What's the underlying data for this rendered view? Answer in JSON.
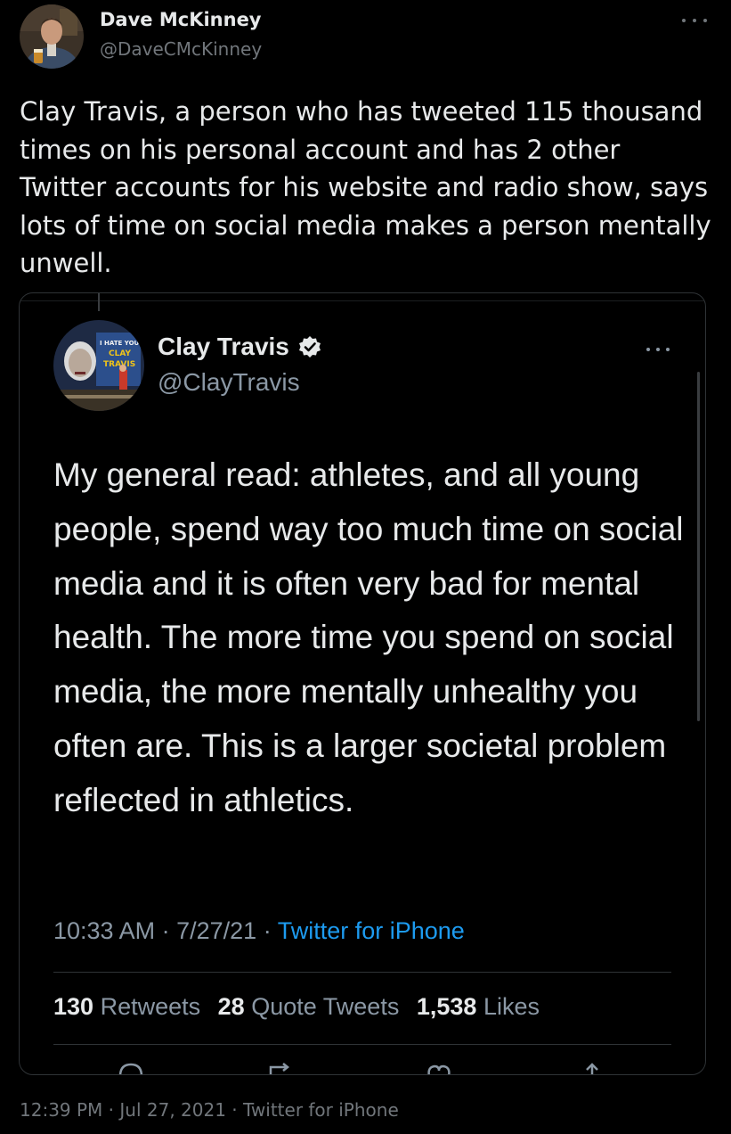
{
  "tweet": {
    "author": {
      "name": "Dave McKinney",
      "handle": "@DaveCMcKinney",
      "avatar_icon": "person-photo-icon"
    },
    "text": "Clay Travis, a person who has tweeted 115 thousand times on his personal account and has 2 other Twitter accounts for his website and radio show, says lots of time on social media makes a person mentally unwell.",
    "timestamp": "12:39 PM · Jul 27, 2021 · Twitter for iPhone",
    "more_icon": "more-dots-icon"
  },
  "quoted": {
    "author": {
      "name": "Clay Travis",
      "handle": "@ClayTravis",
      "verified": true,
      "avatar_sign_text": "I HATE YOU CLAY TRAVIS"
    },
    "text": "My general read: athletes, and all young people, spend way too much time on social media and it is often very bad for mental health. The more time you spend on social media, the more mentally unhealthy you often are. This is a larger societal problem reflected in athletics.",
    "time": "10:33 AM",
    "date": "7/27/21",
    "separator": "·",
    "source": "Twitter for iPhone",
    "stats": {
      "retweets_count": "130",
      "retweets_label": "Retweets",
      "quotes_count": "28",
      "quotes_label": "Quote Tweets",
      "likes_count": "1,538",
      "likes_label": "Likes"
    },
    "actions": [
      "reply-icon",
      "retweet-icon",
      "like-icon",
      "share-icon"
    ]
  },
  "colors": {
    "background": "#000000",
    "text_primary": "#e7e9ea",
    "text_secondary": "#71767b",
    "link": "#1d9bf0",
    "border": "#2f3336"
  }
}
